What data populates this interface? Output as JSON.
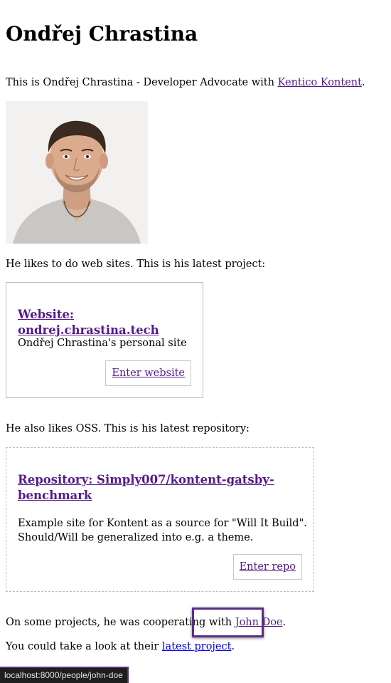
{
  "heading": "Ondřej Chrastina",
  "intro": {
    "prefix": "This is Ondřej Chrastina - Developer Advocate with ",
    "link": "Kentico Kontent",
    "suffix": "."
  },
  "portrait_alt": "Ondřej Chrastina photo",
  "web_intro": "He likes to do web sites. This is his latest project:",
  "website_card": {
    "title": "Website: ondrej.chrastina.tech",
    "description": "Ondřej Chrastina's personal site",
    "button": "Enter website"
  },
  "oss_intro": "He also likes OSS. This is his latest repository:",
  "repo_card": {
    "title_line1": "Repository: Simply007/kontent-gatsby-",
    "title_line2": "benchmark",
    "description_line1": "Example site for Kontent as a source for \"Will It Build\".",
    "description_line2": "Should/Will be generalized into e.g. a theme.",
    "button": "Enter repo"
  },
  "coop": {
    "prefix": "On some projects, he was cooperating with ",
    "link": "John Doe",
    "suffix": "."
  },
  "latest": {
    "prefix": "You could take a look at their ",
    "link": "latest project",
    "suffix": "."
  },
  "status_url": "localhost:8000/people/john-doe",
  "colors": {
    "visited_link": "#551a8b",
    "unvisited_link": "#0000ee",
    "highlight": "#5a2d8c"
  }
}
